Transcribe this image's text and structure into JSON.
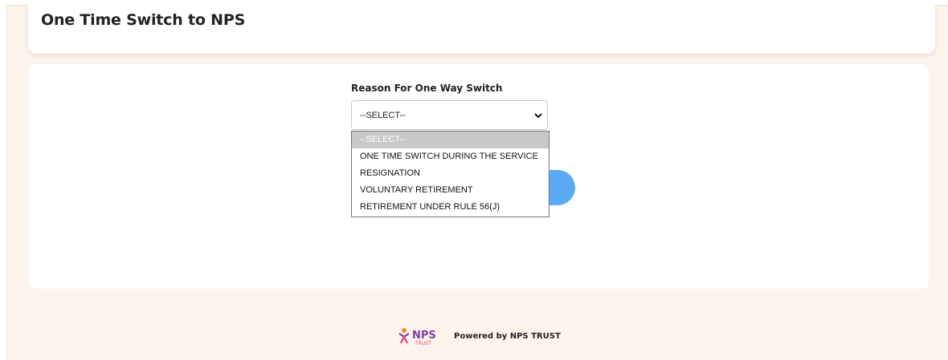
{
  "page": {
    "title": "One Time Switch to NPS"
  },
  "form": {
    "reason_label": "Reason For One Way Switch",
    "reason_select": {
      "selected": "--SELECT--",
      "options": [
        "--SELECT--",
        "ONE TIME SWITCH DURING THE SERVICE",
        "RESIGNATION",
        "VOLUNTARY RETIREMENT",
        "RETIREMENT UNDER RULE 56(J)"
      ]
    }
  },
  "footer": {
    "logo_text": "NPS",
    "logo_subtext": "TRUST",
    "powered_by": "Powered by NPS TRUST"
  },
  "colors": {
    "background": "#fdf4ec",
    "button": "#5aaaf4",
    "logo_purple": "#7b3fa0",
    "logo_orange": "#f28c28"
  }
}
